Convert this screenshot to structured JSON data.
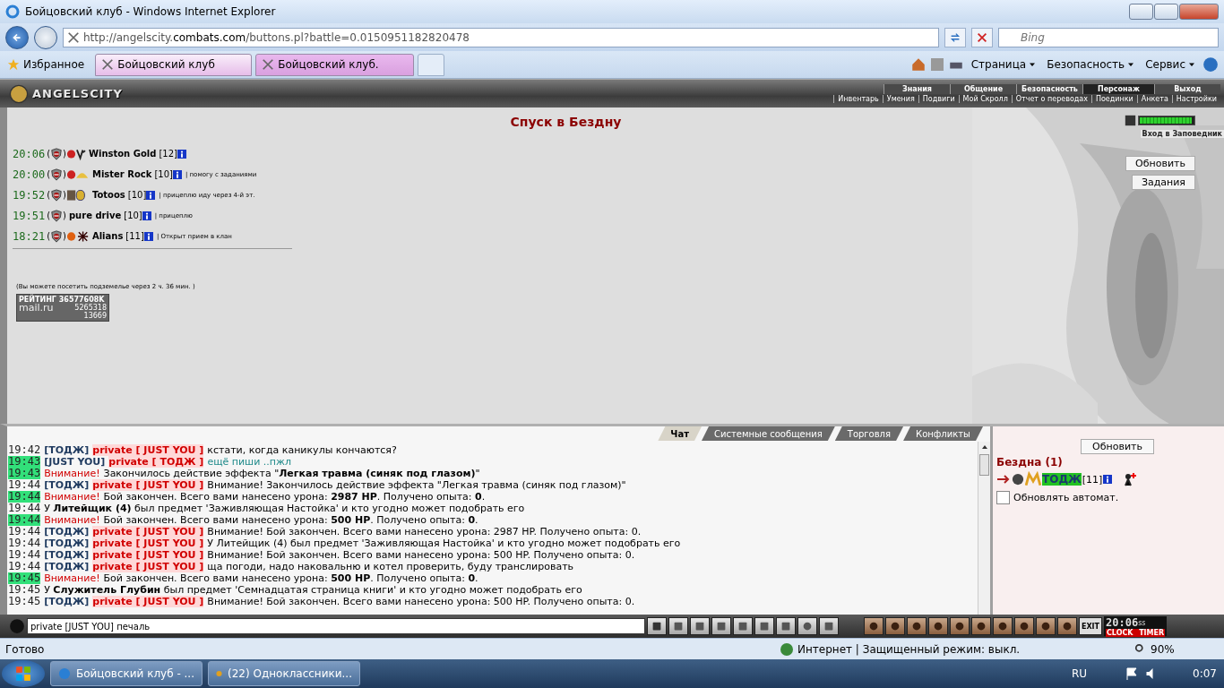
{
  "window": {
    "title": "Бойцовский клуб - Windows Internet Explorer"
  },
  "address_bar": {
    "url_prefix": "http://angelscity.",
    "url_domain": "combats.com",
    "url_rest": "/buttons.pl?battle=0.0150951182820478",
    "search_placeholder": "Bing"
  },
  "favorites": {
    "label": "Избранное"
  },
  "tabs": [
    {
      "label": "Бойцовский клуб",
      "selected": true
    },
    {
      "label": "Бойцовский клуб.",
      "selected": false
    }
  ],
  "command_bar": [
    "Страница",
    "Безопасность",
    "Сервис"
  ],
  "game_header": {
    "logo": "ANGELSCITY",
    "nav": [
      {
        "label": "Знания",
        "selected": false
      },
      {
        "label": "Общение",
        "selected": false
      },
      {
        "label": "Безопасность",
        "selected": false
      },
      {
        "label": "Персонаж",
        "selected": true
      },
      {
        "label": "Выход",
        "selected": false
      }
    ],
    "subnav": [
      "Инвентарь",
      "Умения",
      "Подвиги",
      "Мой Скролл",
      "Отчет о переводах",
      "Поединки",
      "Анкета",
      "Настройки"
    ]
  },
  "page": {
    "title": "Спуск в Бездну",
    "entries": [
      {
        "time": "20:06",
        "bracket_open": "(",
        "bracket_close": ")",
        "name": "Winston Gold",
        "level": "[12]"
      },
      {
        "time": "20:00",
        "bracket_open": "(",
        "bracket_close": ")",
        "name": "Mister Rock",
        "level": "[10]",
        "note": "| помогу с заданиями"
      },
      {
        "time": "19:52",
        "bracket_open": "(",
        "bracket_close": ")",
        "name": "Totoos",
        "level": "[10]",
        "note": "| прицеплю иду через 4-й эт."
      },
      {
        "time": "19:51",
        "bracket_open": "(",
        "bracket_close": ")",
        "name": "pure drive",
        "level": "[10]",
        "note": "| прицеплю"
      },
      {
        "time": "18:21",
        "bracket_open": "(",
        "bracket_close": ")",
        "name": "Alians",
        "level": "[11]",
        "note": "| Открыт прием в клан"
      }
    ],
    "notice": "(Вы можете посетить подземелье через 2 ч. 36 мин. )",
    "counter": {
      "rating": "РЕЙТИНГ 36577608K",
      "logo": "mail.ru",
      "hits": "5265318",
      "hosts": "13669"
    },
    "energy": {
      "level": 0.97
    },
    "reserve_link": "Вход в Заповедник",
    "buttons": [
      "Обновить",
      "Задания"
    ]
  },
  "chat": {
    "tabs": [
      {
        "label": "Чат",
        "selected": true
      },
      {
        "label": "Системные сообщения",
        "selected": false
      },
      {
        "label": "Торговля",
        "selected": false
      },
      {
        "label": "Конфликты",
        "selected": false
      }
    ],
    "messages": [
      {
        "time": "19:42",
        "highlighted": false,
        "kind": "private",
        "from": "[ТОДЖ]",
        "to": "private [ JUST YOU ]",
        "outgoing": false,
        "text": "кстати, когда каникулы кончаются?"
      },
      {
        "time": "19:43",
        "highlighted": true,
        "kind": "private",
        "from": "[JUST YOU]",
        "to": "private [ ТОДЖ ]",
        "outgoing": true,
        "text": "ещё пиши ..пжл"
      },
      {
        "time": "19:43",
        "highlighted": true,
        "kind": "warning",
        "alert": "Внимание!",
        "text": "Закончилось действие эффекта \"**Легкая травма (синяк под глазом)**\""
      },
      {
        "time": "19:44",
        "highlighted": false,
        "kind": "private",
        "from": "[ТОДЖ]",
        "to": "private [ JUST YOU ]",
        "outgoing": false,
        "text": "Внимание! Закончилось действие эффекта \"Легкая травма (синяк под глазом)\""
      },
      {
        "time": "19:44",
        "highlighted": true,
        "kind": "warning",
        "alert": "Внимание!",
        "text": "Бой закончен. Всего вами нанесено урона: **2987 HP**. Получено опыта: **0**."
      },
      {
        "time": "19:44",
        "highlighted": false,
        "kind": "system",
        "text": "У **Литейщик (4)** был предмет 'Заживляющая Настойка' и кто угодно может подобрать его"
      },
      {
        "time": "19:44",
        "highlighted": true,
        "kind": "warning",
        "alert": "Внимание!",
        "text": "Бой закончен. Всего вами нанесено урона: **500 HP**. Получено опыта: **0**."
      },
      {
        "time": "19:44",
        "highlighted": false,
        "kind": "private",
        "from": "[ТОДЖ]",
        "to": "private [ JUST YOU ]",
        "outgoing": false,
        "text": "Внимание! Бой закончен. Всего вами нанесено урона: 2987 HP. Получено опыта: 0."
      },
      {
        "time": "19:44",
        "highlighted": false,
        "kind": "private",
        "from": "[ТОДЖ]",
        "to": "private [ JUST YOU ]",
        "outgoing": false,
        "text": "У Литейщик (4) был предмет 'Заживляющая Настойка' и кто угодно может подобрать его"
      },
      {
        "time": "19:44",
        "highlighted": false,
        "kind": "private",
        "from": "[ТОДЖ]",
        "to": "private [ JUST YOU ]",
        "outgoing": false,
        "text": "Внимание! Бой закончен. Всего вами нанесено урона: 500 HP. Получено опыта: 0."
      },
      {
        "time": "19:44",
        "highlighted": false,
        "kind": "private",
        "from": "[ТОДЖ]",
        "to": "private [ JUST YOU ]",
        "outgoing": false,
        "text": "ща погоди, надо наковальню и котел проверить, буду транслировать"
      },
      {
        "time": "19:45",
        "highlighted": true,
        "kind": "warning",
        "alert": "Внимание!",
        "text": "Бой закончен. Всего вами нанесено урона: **500 HP**. Получено опыта: **0**."
      },
      {
        "time": "19:45",
        "highlighted": false,
        "kind": "system",
        "text": "У **Служитель Глубин** был предмет 'Семнадцатая страница книги' и кто угодно может подобрать его"
      },
      {
        "time": "19:45",
        "highlighted": false,
        "kind": "private",
        "from": "[ТОДЖ]",
        "to": "private [ JUST YOU ]",
        "outgoing": false,
        "text": "Внимание! Бой закончен. Всего вами нанесено урона: 500 HP. Получено опыта: 0."
      }
    ],
    "input": {
      "value": "private [JUST YOU] печаль"
    },
    "clock": {
      "time": "20:06",
      "seconds": "ss",
      "clock_label": "CLOCK",
      "timer_label": "TIMER",
      "exit_label": "EXIT"
    }
  },
  "online_panel": {
    "refresh": "Обновить",
    "location": "Бездна (1)",
    "users": [
      {
        "name": "ТОДЖ",
        "level": "[11]"
      }
    ],
    "auto_refresh": {
      "label": "Обновлять автомат.",
      "checked": false
    }
  },
  "status_bar": {
    "text": "Готово",
    "zone": "Интернет | Защищенный режим: выкл.",
    "zoom": "90%"
  },
  "taskbar": {
    "items": [
      "Бойцовский клуб - ...",
      "(22) Одноклассники..."
    ],
    "language": "RU",
    "time": "0:07"
  }
}
